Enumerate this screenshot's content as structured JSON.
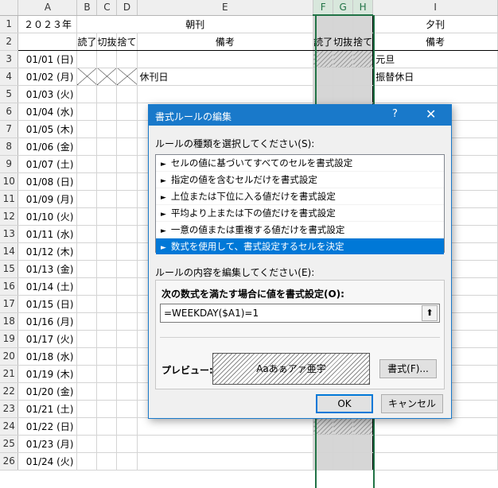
{
  "columns": [
    "A",
    "B",
    "C",
    "D",
    "E",
    "F",
    "G",
    "H",
    "I"
  ],
  "selected_columns": [
    "F",
    "G",
    "H"
  ],
  "header_row1": {
    "year": "２０２３年",
    "morning": "朝刊",
    "evening": "夕刊"
  },
  "header_row2": {
    "read": "読了",
    "clip": "切抜",
    "discard": "捨て",
    "notes": "備考",
    "read2": "読了",
    "clip2": "切抜",
    "discard2": "捨て",
    "notes2": "備考"
  },
  "rows": [
    {
      "n": "3",
      "date": "01/01 (日)",
      "morning_note": "",
      "evening_note": "元旦"
    },
    {
      "n": "4",
      "date": "01/02 (月)",
      "morning_note": "休刊日",
      "evening_note": "振替休日"
    },
    {
      "n": "5",
      "date": "01/03 (火)"
    },
    {
      "n": "6",
      "date": "01/04 (水)"
    },
    {
      "n": "7",
      "date": "01/05 (木)"
    },
    {
      "n": "8",
      "date": "01/06 (金)"
    },
    {
      "n": "9",
      "date": "01/07 (土)"
    },
    {
      "n": "10",
      "date": "01/08 (日)"
    },
    {
      "n": "11",
      "date": "01/09 (月)"
    },
    {
      "n": "12",
      "date": "01/10 (火)"
    },
    {
      "n": "13",
      "date": "01/11 (水)"
    },
    {
      "n": "14",
      "date": "01/12 (木)"
    },
    {
      "n": "15",
      "date": "01/13 (金)"
    },
    {
      "n": "16",
      "date": "01/14 (土)"
    },
    {
      "n": "17",
      "date": "01/15 (日)"
    },
    {
      "n": "18",
      "date": "01/16 (月)"
    },
    {
      "n": "19",
      "date": "01/17 (火)"
    },
    {
      "n": "20",
      "date": "01/18 (水)"
    },
    {
      "n": "21",
      "date": "01/19 (木)"
    },
    {
      "n": "22",
      "date": "01/20 (金)"
    },
    {
      "n": "23",
      "date": "01/21 (土)"
    },
    {
      "n": "24",
      "date": "01/22 (日)"
    },
    {
      "n": "25",
      "date": "01/23 (月)"
    },
    {
      "n": "26",
      "date": "01/24 (火)"
    }
  ],
  "dialog": {
    "title": "書式ルールの編集",
    "help": "?",
    "close": "✕",
    "rule_type_label": "ルールの種類を選択してください(S):",
    "rule_types": [
      "セルの値に基づいてすべてのセルを書式設定",
      "指定の値を含むセルだけを書式設定",
      "上位または下位に入る値だけを書式設定",
      "平均より上または下の値だけを書式設定",
      "一意の値または重複する値だけを書式設定",
      "数式を使用して、書式設定するセルを決定"
    ],
    "selected_rule": "数式を使用して、書式設定するセルを決定",
    "edit_label": "ルールの内容を編集してください(E):",
    "formula_label": "次の数式を満たす場合に値を書式設定(O):",
    "formula": "=WEEKDAY($A1)=1",
    "preview_label": "プレビュー:",
    "preview_text": "Aaあぁアァ亜宇",
    "format_button": "書式(F)...",
    "ok": "OK",
    "cancel": "キャンセル"
  }
}
